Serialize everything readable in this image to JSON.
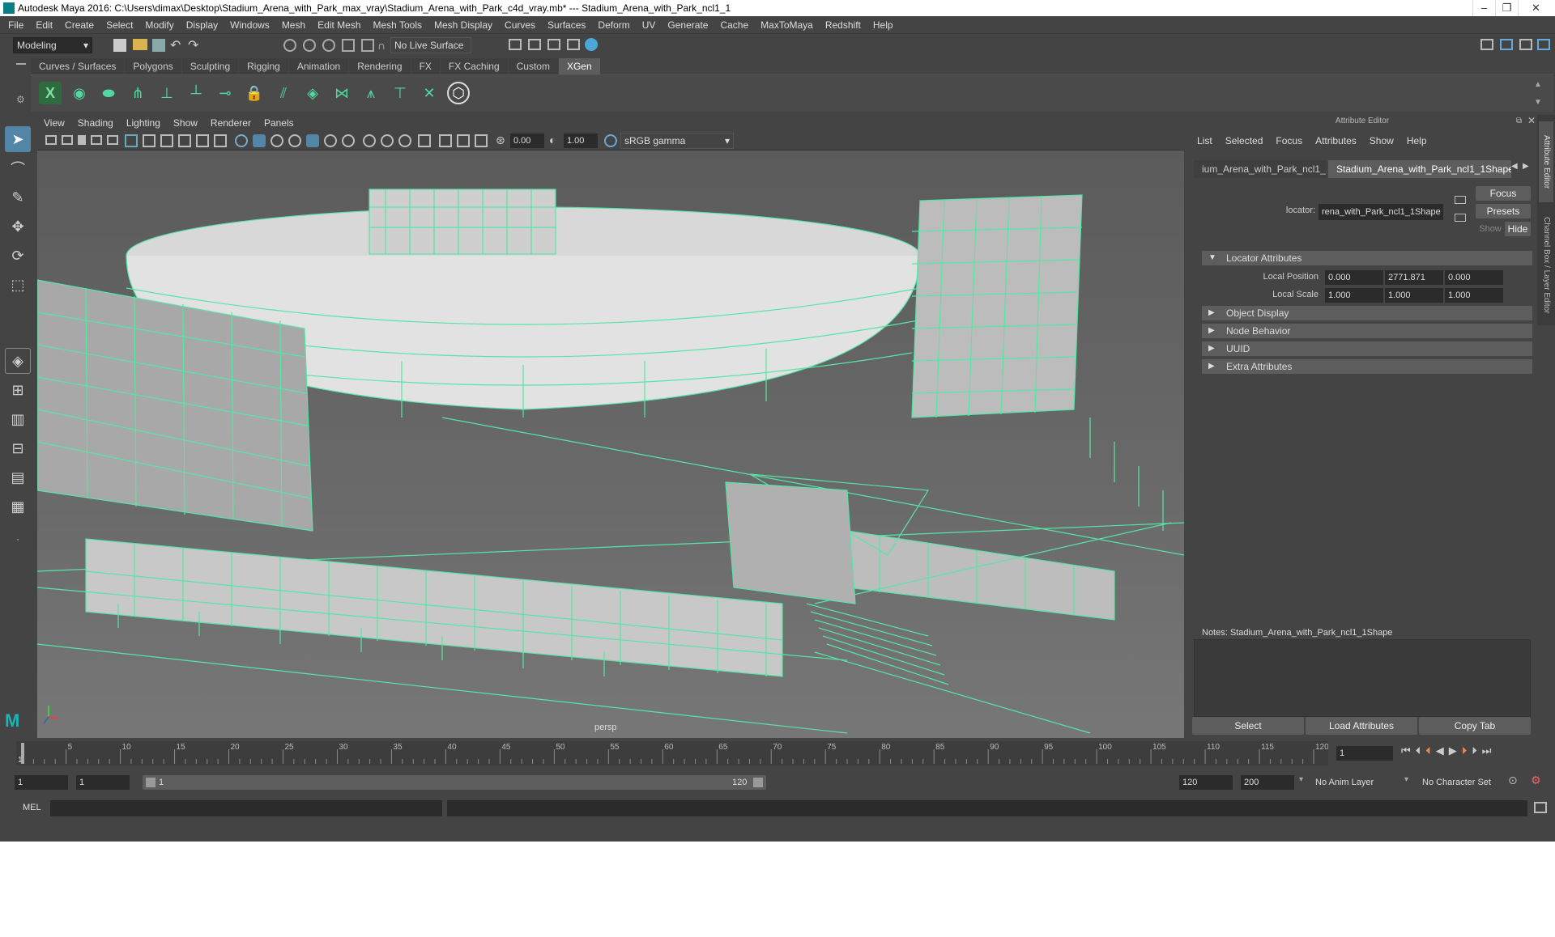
{
  "window": {
    "title": "Autodesk Maya 2016: C:\\Users\\dimax\\Desktop\\Stadium_Arena_with_Park_max_vray\\Stadium_Arena_with_Park_c4d_vray.mb*  ---  Stadium_Arena_with_Park_ncl1_1"
  },
  "menus": [
    "File",
    "Edit",
    "Create",
    "Select",
    "Modify",
    "Display",
    "Windows",
    "Mesh",
    "Edit Mesh",
    "Mesh Tools",
    "Mesh Display",
    "Curves",
    "Surfaces",
    "Deform",
    "UV",
    "Generate",
    "Cache",
    "MaxToMaya",
    "Redshift",
    "Help"
  ],
  "status": {
    "mode": "Modeling",
    "live_surface": "No Live Surface"
  },
  "shelf_tabs": [
    "Curves / Surfaces",
    "Polygons",
    "Sculpting",
    "Rigging",
    "Animation",
    "Rendering",
    "FX",
    "FX Caching",
    "Custom",
    "XGen"
  ],
  "shelf_active": "XGen",
  "viewport": {
    "menus": [
      "View",
      "Shading",
      "Lighting",
      "Show",
      "Renderer",
      "Panels"
    ],
    "exposure": "0.00",
    "gamma": "1.00",
    "color_space": "sRGB gamma",
    "camera": "persp"
  },
  "attribute_editor": {
    "title": "Attribute Editor",
    "menus": [
      "List",
      "Selected",
      "Focus",
      "Attributes",
      "Show",
      "Help"
    ],
    "tabs": [
      "ium_Arena_with_Park_ncl1_1",
      "Stadium_Arena_with_Park_ncl1_1Shape"
    ],
    "locator_label": "locator:",
    "locator_value": "rena_with_Park_ncl1_1Shape",
    "focus_btn": "Focus",
    "presets_btn": "Presets",
    "show_btn": "Show",
    "hide_btn": "Hide",
    "sections": [
      {
        "name": "Locator Attributes",
        "open": true
      },
      {
        "name": "Object Display",
        "open": false
      },
      {
        "name": "Node Behavior",
        "open": false
      },
      {
        "name": "UUID",
        "open": false
      },
      {
        "name": "Extra Attributes",
        "open": false
      }
    ],
    "local_position_label": "Local Position",
    "local_position": [
      "0.000",
      "2771.871",
      "0.000"
    ],
    "local_scale_label": "Local Scale",
    "local_scale": [
      "1.000",
      "1.000",
      "1.000"
    ],
    "notes_label": "Notes:  Stadium_Arena_with_Park_ncl1_1Shape",
    "bottom_buttons": [
      "Select",
      "Load Attributes",
      "Copy Tab"
    ],
    "side_tabs": [
      "Attribute Editor",
      "Channel Box / Layer Editor"
    ]
  },
  "timeline": {
    "ticks": [
      5,
      10,
      15,
      20,
      25,
      30,
      35,
      40,
      45,
      50,
      55,
      60,
      65,
      70,
      75,
      80,
      85,
      90,
      95,
      100,
      105,
      110,
      115,
      120
    ],
    "start_label": "1",
    "current_frame": "1"
  },
  "range": {
    "start": "1",
    "playback_start": "1",
    "slider_start": "1",
    "slider_end": "120",
    "playback_end": "120",
    "end": "200",
    "anim_layer": "No Anim Layer",
    "char_set": "No Character Set"
  },
  "command": {
    "lang": "MEL"
  }
}
